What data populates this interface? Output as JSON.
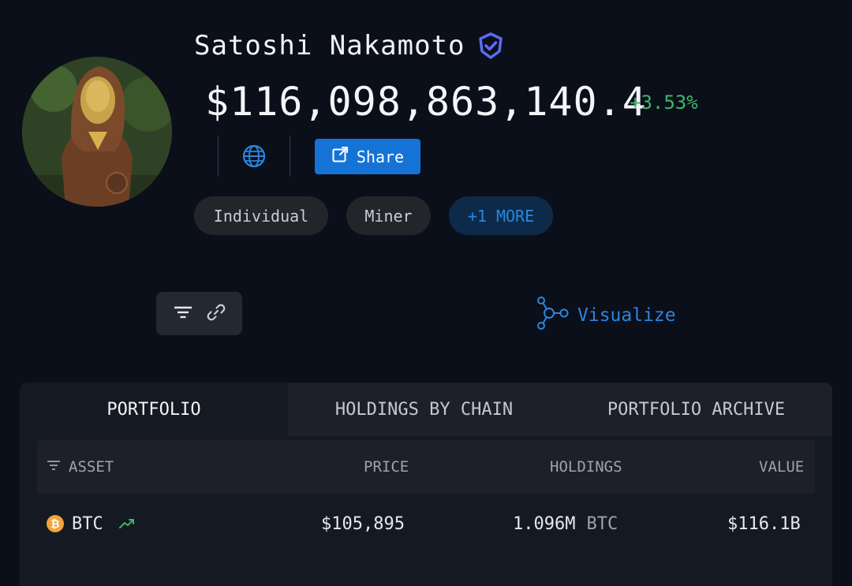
{
  "profile": {
    "name": "Satoshi Nakamoto",
    "verified_icon": "shield-check-icon",
    "balance": "$116,098,863,140.4",
    "change": "+3.53%",
    "share_label": "Share",
    "tags": [
      "Individual",
      "Miner",
      "+1 MORE"
    ]
  },
  "toolbar": {
    "visualize_label": "Visualize"
  },
  "tabs": [
    "PORTFOLIO",
    "HOLDINGS BY CHAIN",
    "PORTFOLIO ARCHIVE"
  ],
  "table": {
    "headers": {
      "asset": "ASSET",
      "price": "PRICE",
      "holdings": "HOLDINGS",
      "value": "VALUE"
    },
    "rows": [
      {
        "symbol": "BTC",
        "price": "$105,895",
        "amount": "1.096M",
        "unit": "BTC",
        "value": "$116.1B"
      }
    ]
  },
  "colors": {
    "accent": "#1573d6",
    "positive": "#3fb56a",
    "bitcoin": "#f2a33a",
    "background": "#0b0f1a"
  }
}
